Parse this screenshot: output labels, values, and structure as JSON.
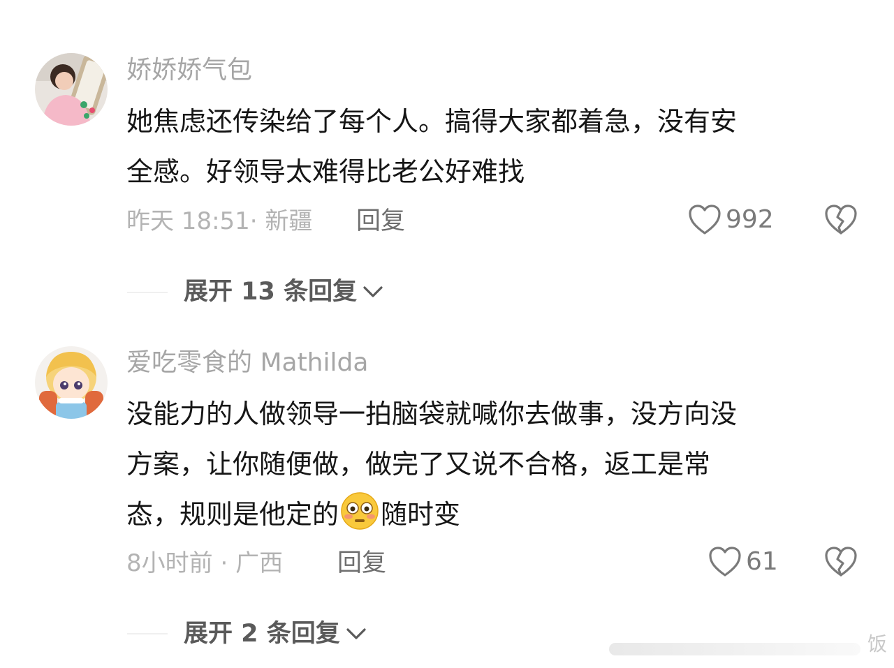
{
  "comments": [
    {
      "username": "娇娇娇气包",
      "content_lines": [
        "她焦虑还传染给了每个人。搞得大家都着急，没有安",
        "全感。好领导太难得比老公好难找"
      ],
      "time": "昨天 18:51",
      "location": "新疆",
      "reply_label": "回复",
      "likes": "992",
      "expand_label": "展开 13 条回复"
    },
    {
      "username": "爱吃零食的 Mathilda",
      "content_line1": "没能力的人做领导一拍脑袋就喊你去做事，没方向没",
      "content_line2": "方案，让你随便做，做完了又说不合格，返工是常",
      "content_line3_before": "态，规则是他定的",
      "content_line3_emoji": "flushed-emoji",
      "content_line3_after": "随时变",
      "time": "8小时前",
      "location": "广西",
      "reply_label": "回复",
      "likes": "61",
      "expand_label": "展开 2 条回复"
    }
  ],
  "watermark": "饭",
  "icons": {
    "like": "heart-outline-icon",
    "dislike": "broken-heart-icon",
    "expand": "chevron-down-icon"
  },
  "colors": {
    "username": "#a6a6a6",
    "content": "#161616",
    "meta": "#b3b3b3",
    "icon": "#7a7a7a"
  }
}
